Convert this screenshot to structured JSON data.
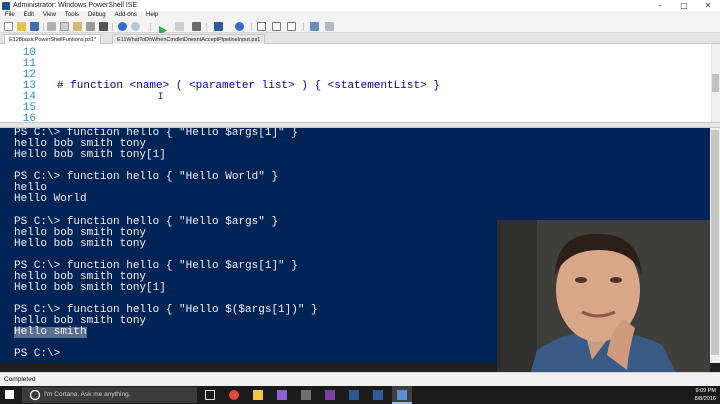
{
  "window": {
    "title": "Administrator: Windows PowerShell ISE",
    "controls": [
      "–",
      "□",
      "✕"
    ]
  },
  "menu": {
    "items": [
      "File",
      "Edit",
      "View",
      "Tools",
      "Debug",
      "Add-ons",
      "Help"
    ]
  },
  "tabs": [
    {
      "label": "E128basicPowerShellFuntions.ps1*",
      "active": true
    },
    {
      "label": "E11WhatToDoWhenCmdletDoesntAcceptPipelineInput.ps1",
      "active": false
    }
  ],
  "editor": {
    "lines": [
      {
        "num": "10",
        "code": ""
      },
      {
        "num": "11",
        "code": ""
      },
      {
        "num": "12",
        "code": ""
      },
      {
        "num": "13",
        "code": "# function <name> ( <parameter list> ) { <statementList> }"
      },
      {
        "num": "14",
        "code": ""
      },
      {
        "num": "15",
        "code": ""
      },
      {
        "num": "16",
        "code": ""
      }
    ],
    "cursor_glyph": "I"
  },
  "console": {
    "lines": [
      {
        "text": "PS C:\\> function hello { \"Hello $args[1]\" }",
        "highlight": false
      },
      {
        "text": "hello bob smith tony",
        "highlight": false
      },
      {
        "text": "Hello bob smith tony[1]",
        "highlight": false
      },
      {
        "text": "",
        "highlight": false
      },
      {
        "text": "PS C:\\> function hello { \"Hello World\" }",
        "highlight": false
      },
      {
        "text": "hello",
        "highlight": false
      },
      {
        "text": "Hello World",
        "highlight": false
      },
      {
        "text": "",
        "highlight": false
      },
      {
        "text": "PS C:\\> function hello { \"Hello $args\" }",
        "highlight": false
      },
      {
        "text": "hello bob smith tony",
        "highlight": false
      },
      {
        "text": "Hello bob smith tony",
        "highlight": false
      },
      {
        "text": "",
        "highlight": false
      },
      {
        "text": "PS C:\\> function hello { \"Hello $args[1]\" }",
        "highlight": false
      },
      {
        "text": "hello bob smith tony",
        "highlight": false
      },
      {
        "text": "Hello bob smith tony[1]",
        "highlight": false
      },
      {
        "text": "",
        "highlight": false
      },
      {
        "text": "PS C:\\> function hello { \"Hello $($args[1])\" }",
        "highlight": false
      },
      {
        "text": "hello bob smith tony",
        "highlight": false
      },
      {
        "text": "Hello smith",
        "highlight": true
      },
      {
        "text": "",
        "highlight": false
      },
      {
        "text": "PS C:\\>",
        "highlight": false
      }
    ]
  },
  "status": {
    "text": "Completed"
  },
  "taskbar": {
    "cortana_placeholder": "I'm Cortana. Ask me anything.",
    "time": "9:09 PM",
    "date": "8/8/2016"
  },
  "colors": {
    "console_bg": "#012456",
    "editor_comment": "#0000a8",
    "line_number": "#2b91af",
    "highlight": "#5a6f8f"
  }
}
